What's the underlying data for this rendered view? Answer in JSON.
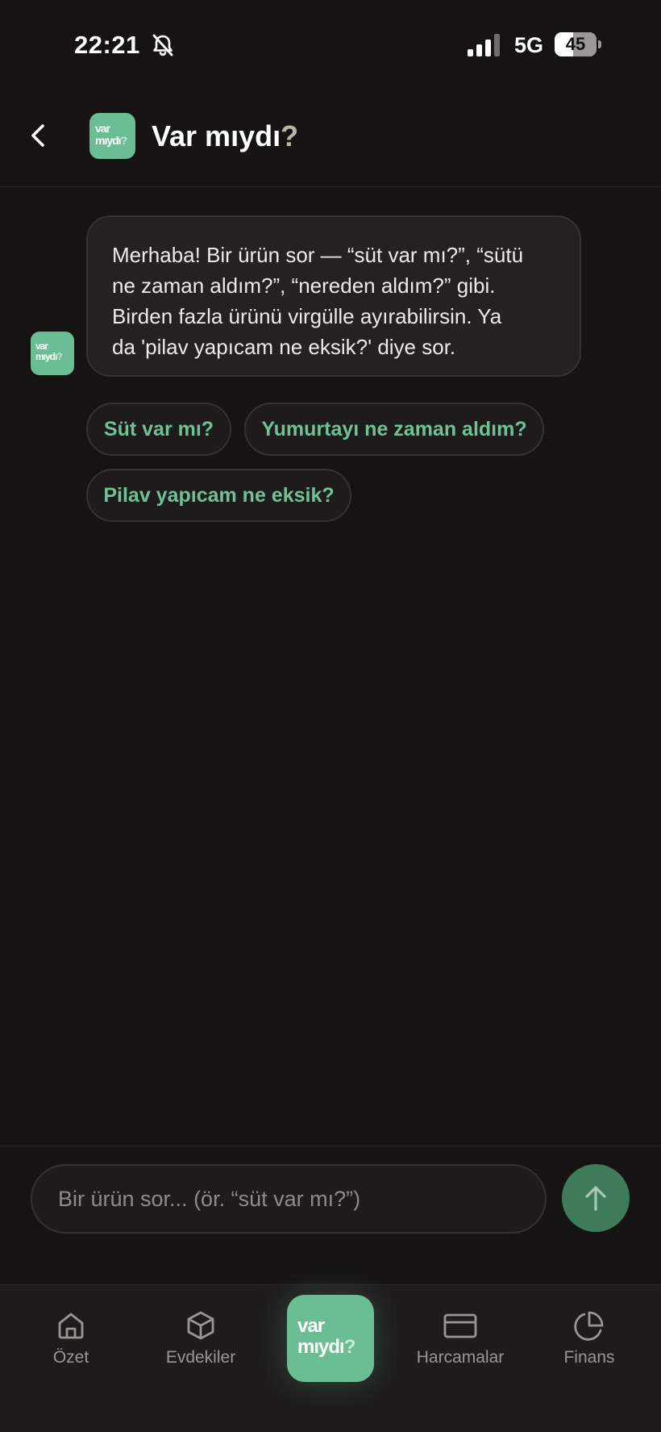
{
  "status_bar": {
    "time": "22:21",
    "network": "5G",
    "battery": "45",
    "battery_level": 0.45
  },
  "header": {
    "back_icon": "chevron-left-icon",
    "logo": {
      "line1": "var",
      "line2": "mıydı",
      "q": "?"
    },
    "title_main": "Var mıydı",
    "title_q": "?"
  },
  "chat": {
    "bot_message": {
      "lines": [
        "Merhaba! Bir ürün sor — “süt var mı?”, “sütü",
        "ne zaman aldım?”, “nereden aldım?” gibi.",
        "Birden fazla ürünü virgülle ayırabilirsin. Ya",
        "da 'pilav yapıcam ne eksik?' diye sor."
      ]
    },
    "suggestions": [
      "Süt var mı?",
      "Yumurtayı ne zaman aldım?",
      "Pilav yapıcam ne eksik?"
    ]
  },
  "composer": {
    "placeholder": "Bir ürün sor... (ör. “süt var mı?”)",
    "send_icon": "arrow-up-icon"
  },
  "tab_bar": {
    "tabs": [
      {
        "label": "Özet",
        "icon": "home-icon"
      },
      {
        "label": "Evdekiler",
        "icon": "box-icon"
      },
      {
        "label": "Harcamalar",
        "icon": "credit-card-icon"
      },
      {
        "label": "Finans",
        "icon": "pie-chart-icon"
      }
    ],
    "center": {
      "line1": "var",
      "line2": "mıydı",
      "q": "?"
    }
  },
  "colors": {
    "background": "#161412",
    "accent": "#6BBE93",
    "chip_text": "#6FC296",
    "send_button": "#3F7A5B",
    "bubble": "#242220"
  }
}
